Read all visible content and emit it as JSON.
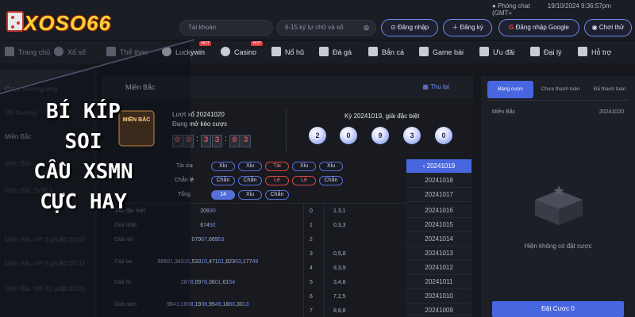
{
  "brand": {
    "logo_text": "XOSO66"
  },
  "top": {
    "chat": "Phòng chat",
    "datetime": "19/10/2024 9:36:57pm",
    "timezone": "(GMT+"
  },
  "auth": {
    "username_placeholder": "Tài khoản",
    "password_placeholder": "6-15 ký tự chữ và số",
    "login": "Đăng nhập",
    "register": "Đăng ký",
    "google": "Đăng nhập Google",
    "trial": "Chơi thử"
  },
  "nav": [
    {
      "label": "Trang chủ"
    },
    {
      "label": "Xổ số"
    },
    {
      "label": "Thể thao"
    },
    {
      "label": "Luckywin",
      "badge": "HOT"
    },
    {
      "label": "Casino",
      "badge": "HOT"
    },
    {
      "label": "Nổ hũ"
    },
    {
      "label": "Đá gà"
    },
    {
      "label": "Bắn cá"
    },
    {
      "label": "Game bài"
    },
    {
      "label": "Ưu đãi"
    },
    {
      "label": "Đại lý"
    },
    {
      "label": "Hỗ trợ"
    }
  ],
  "sidebar": {
    "items": [
      "Cược thường lang",
      "Mở thưởng",
      "Miền Bắc",
      "Miền Bắc",
      "Miền Bắc SVIP 1",
      "Miền Bắc VIP 3 phút",
      "Miền Bắc VIP 5 phút",
      "Miền Bắc VIP 45 giây"
    ],
    "times": [
      "00:30:03",
      "00:00:32",
      "00:00:03"
    ]
  },
  "overlay": {
    "line1": "BÍ KÍP SOI",
    "line2": "CẦU XSMN",
    "line3": "CỰC HAY"
  },
  "panel": {
    "title": "Miền Bắc",
    "history_btn": "Thu lại",
    "draw_label": "Lượt xổ 20241020",
    "countdown_label": "Đang mở kèo cược",
    "countdown": [
      "0",
      "0",
      "3",
      "3",
      "0",
      "3"
    ],
    "result_label": "Kỳ 20241019, giải đặc biệt",
    "special_balls": [
      "2",
      "0",
      "9",
      "3",
      "0"
    ],
    "rows": [
      {
        "label": "Tài xỉu",
        "pills": [
          "Xỉu",
          "Xỉu",
          "Tài",
          "Xỉu",
          "Xỉu"
        ]
      },
      {
        "label": "Chẵn lẻ",
        "pills": [
          "Chẵn",
          "Chẵn",
          "Lẻ",
          "Lẻ",
          "Chẵn"
        ]
      },
      {
        "label": "Tổng",
        "pills": [
          "14",
          "Xỉu",
          "Chẵn"
        ]
      }
    ],
    "prizes": [
      {
        "name": "Giải đặc biệt",
        "value": "20930",
        "idx": "0",
        "nums": "1,3,1"
      },
      {
        "name": "Giải nhất",
        "value": "67492",
        "idx": "1",
        "nums": "0,3,3"
      },
      {
        "name": "Giải nhì",
        "value": "07967,66953",
        "idx": "2",
        "nums": ""
      },
      {
        "name": "Giải ba",
        "value": "65681,34335,53310,47101,82303,17749",
        "idx": "3",
        "nums": "0,5,8"
      },
      {
        "name": "",
        "value": "",
        "idx": "4",
        "nums": "9,3,9"
      },
      {
        "name": "Giải tư",
        "value": "2878,0978,3601,6154",
        "idx": "5",
        "nums": "3,4,8"
      },
      {
        "name": "",
        "value": "",
        "idx": "6",
        "nums": "7,2,5"
      },
      {
        "name": "Giải năm",
        "value": "9643,1658,1938,9549,1880,3013",
        "idx": "7",
        "nums": "8,8,8"
      }
    ],
    "dates": [
      "20241019",
      "20241018",
      "20241017",
      "20241016",
      "20241015",
      "20241014",
      "20241013",
      "20241012",
      "20241011",
      "20241010",
      "20241009"
    ]
  },
  "bet": {
    "tabs": [
      "Bảng cược",
      "Chưa thanh toán",
      "Đã thanh toán"
    ],
    "region": "Miền Bắc",
    "date": "20241020",
    "empty": "Hiện không có đặt cược",
    "submit": "Đặt Cược 0"
  }
}
